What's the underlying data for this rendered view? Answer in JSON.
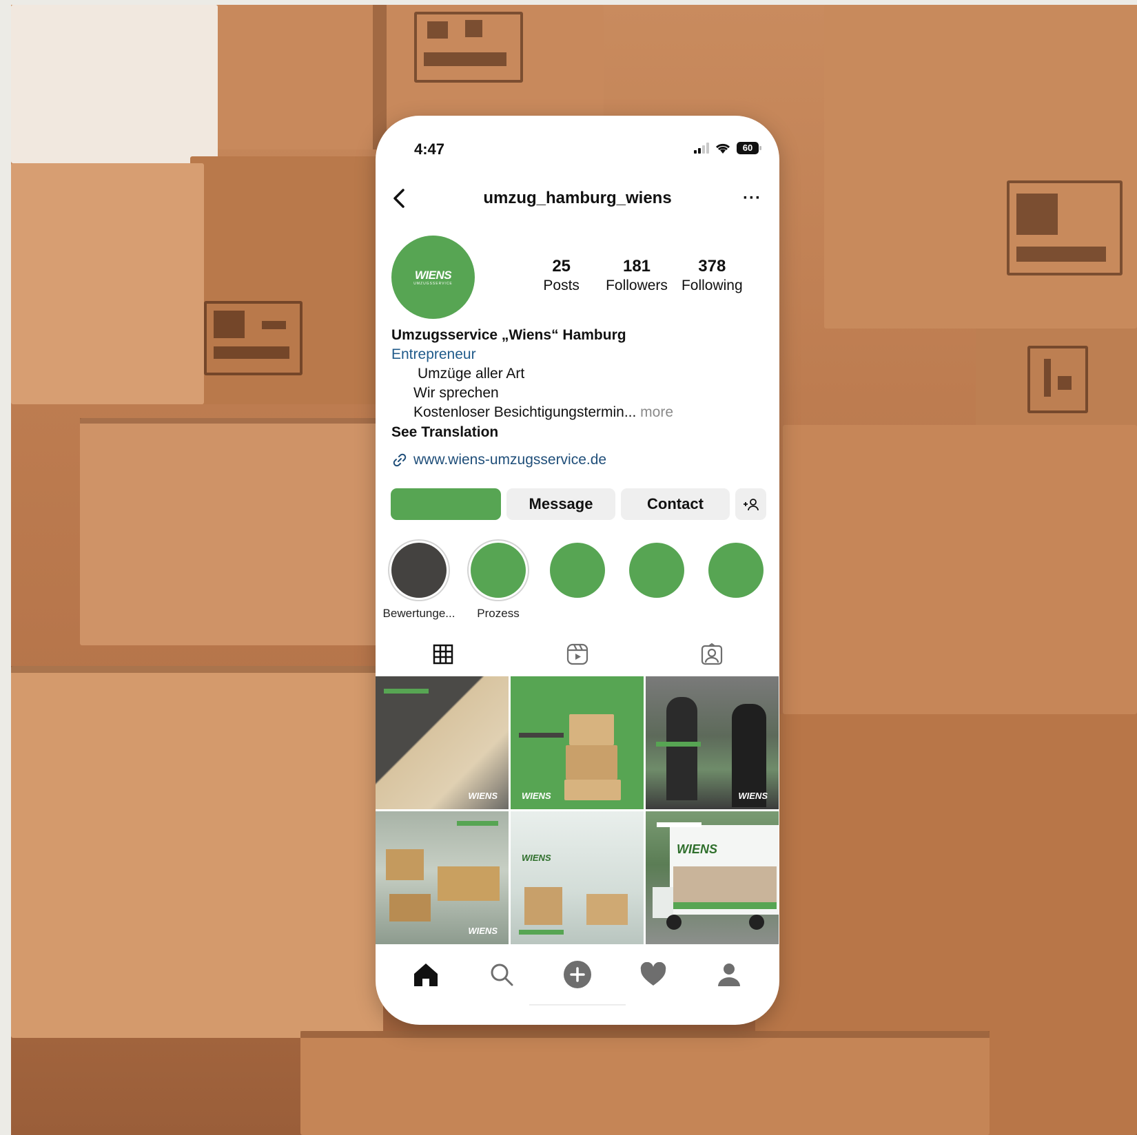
{
  "status_bar": {
    "time": "4:47",
    "battery": "60"
  },
  "header": {
    "username": "umzug_hamburg_wiens",
    "more": "···"
  },
  "profile": {
    "avatar_logo": "WIENS",
    "avatar_logo_sub": "UMZUGSSERVICE",
    "stats": [
      {
        "value": "25",
        "label": "Posts"
      },
      {
        "value": "181",
        "label": "Followers"
      },
      {
        "value": "378",
        "label": "Following"
      }
    ],
    "name": "Umzugsservice „Wiens“ Hamburg",
    "category": "Entrepreneur",
    "bio_lines": [
      "Umzüge aller Art",
      "Wir sprechen",
      "Kostenloser Besichtigungstermin..."
    ],
    "bio_more": "more",
    "see_translation": "See Translation",
    "website": "www.wiens-umzugsservice.de"
  },
  "buttons": {
    "follow": "",
    "message": "Message",
    "contact": "Contact",
    "add_user": "+👤"
  },
  "highlights": [
    {
      "label": "Bewertunge...",
      "color": "#444240"
    },
    {
      "label": "Prozess",
      "color": "#57a553"
    },
    {
      "label": "",
      "color": "#57a553"
    },
    {
      "label": "",
      "color": "#57a553"
    },
    {
      "label": "",
      "color": "#57a553"
    }
  ],
  "tabs": [
    "grid-icon",
    "reels-icon",
    "tagged-icon"
  ],
  "posts": [
    {
      "watermark": "WIENS",
      "theme": "drawer"
    },
    {
      "watermark": "WIENS",
      "theme": "boxes-trolley"
    },
    {
      "watermark": "WIENS",
      "theme": "movers"
    },
    {
      "watermark": "WIENS",
      "theme": "carrying-boxes"
    },
    {
      "watermark": "WIENS",
      "theme": "office-move"
    },
    {
      "watermark": "WIENS",
      "theme": "van"
    }
  ],
  "bottom_nav": [
    "home-icon",
    "search-icon",
    "create-icon",
    "activity-icon",
    "profile-icon"
  ],
  "colors": {
    "brand_green": "#57a553",
    "link_blue": "#1f4e79",
    "category_blue": "#1f5a8a"
  }
}
